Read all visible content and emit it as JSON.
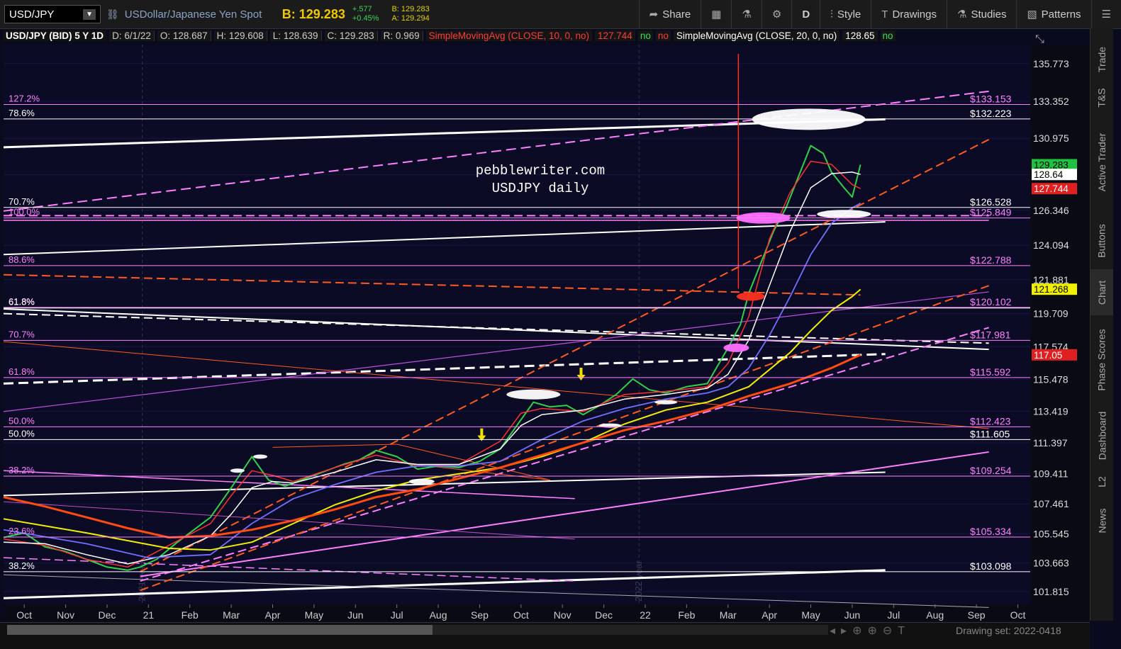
{
  "toolbar": {
    "symbol": "USD/JPY",
    "description": "USDollar/Japanese Yen Spot",
    "bid": "B: 129.283",
    "change": "+.577",
    "change_pct": "+0.45%",
    "bid_small": "B: 129.283",
    "ask_small": "A: 129.294",
    "share": "Share",
    "period": "D",
    "style": "Style",
    "drawings": "Drawings",
    "studies": "Studies",
    "patterns": "Patterns"
  },
  "infobar": {
    "symbol": "USD/JPY (BID) 5 Y 1D",
    "date": "D: 6/1/22",
    "open": "O: 128.687",
    "high": "H: 129.608",
    "low": "L: 128.639",
    "close": "C: 129.283",
    "range": "R: 0.969",
    "sma10": "SimpleMovingAvg (CLOSE, 10, 0, no)",
    "sma10_val": "127.744",
    "no1": "no",
    "no2": "no",
    "sma20": "SimpleMovingAvg (CLOSE, 20, 0, no)",
    "sma20_val": "128.65",
    "no3": "no"
  },
  "side_tabs": [
    "Trade",
    "T&S",
    "Active Trader",
    "Buttons",
    "Chart",
    "Phase Scores",
    "Dashboard",
    "L2",
    "News"
  ],
  "bottom": {
    "drawing_set": "Drawing set: 2022-0418"
  },
  "colors": {
    "background": "#0a0a1e",
    "price": "#2fd14a",
    "sma10": "#ff3030",
    "sma20": "#ffffff",
    "sma50": "#7070ff",
    "sma100": "#f0f000",
    "sma200": "#ff4a10",
    "fib": "#ff80ff"
  },
  "chart_data": {
    "type": "line",
    "title": "pebblewriter.com",
    "subtitle": "USDJPY daily",
    "ylim": [
      101.0,
      137.0
    ],
    "y_ticks": [
      135.773,
      133.352,
      130.975,
      128.64,
      126.346,
      124.094,
      121.881,
      119.709,
      117.574,
      115.478,
      113.419,
      111.397,
      109.411,
      107.461,
      105.545,
      103.663,
      101.815
    ],
    "x_months": [
      {
        "label": "Oct",
        "t": 0.5
      },
      {
        "label": "Nov",
        "t": 1.5
      },
      {
        "label": "Dec",
        "t": 2.5
      },
      {
        "label": "21",
        "t": 3.5
      },
      {
        "label": "Feb",
        "t": 4.5
      },
      {
        "label": "Mar",
        "t": 5.5
      },
      {
        "label": "Apr",
        "t": 6.5
      },
      {
        "label": "May",
        "t": 7.5
      },
      {
        "label": "Jun",
        "t": 8.5
      },
      {
        "label": "Jul",
        "t": 9.5
      },
      {
        "label": "Aug",
        "t": 10.5
      },
      {
        "label": "Sep",
        "t": 11.5
      },
      {
        "label": "Oct",
        "t": 12.5
      },
      {
        "label": "Nov",
        "t": 13.5
      },
      {
        "label": "Dec",
        "t": 14.5
      },
      {
        "label": "22",
        "t": 15.5
      },
      {
        "label": "Feb",
        "t": 16.5
      },
      {
        "label": "Mar",
        "t": 17.5
      },
      {
        "label": "Apr",
        "t": 18.5
      },
      {
        "label": "May",
        "t": 19.5
      },
      {
        "label": "Jun",
        "t": 20.5
      },
      {
        "label": "Jul",
        "t": 21.5
      },
      {
        "label": "Aug",
        "t": 22.5
      },
      {
        "label": "Sep",
        "t": 23.5
      },
      {
        "label": "Oct",
        "t": 24.5
      }
    ],
    "year_markers": [
      {
        "label": "2021 year",
        "t": 3.35
      },
      {
        "label": "2022 year",
        "t": 15.35
      }
    ],
    "series": [
      {
        "name": "USD/JPY",
        "role": "price",
        "t": [
          0.0,
          0.5,
          1.0,
          1.5,
          2.0,
          2.5,
          3.0,
          3.3,
          3.7,
          4.2,
          4.6,
          5.0,
          5.5,
          6.0,
          6.4,
          6.8,
          7.2,
          7.7,
          8.2,
          8.6,
          9.0,
          9.5,
          10.0,
          10.5,
          11.0,
          11.5,
          12.0,
          12.4,
          12.8,
          13.2,
          13.6,
          14.0,
          14.4,
          14.8,
          15.2,
          15.6,
          16.0,
          16.5,
          17.0,
          17.5,
          17.8,
          18.0,
          18.3,
          18.6,
          18.9,
          19.2,
          19.5,
          19.8,
          20.0,
          20.3,
          20.5,
          20.7
        ],
        "values": [
          105.3,
          105.6,
          104.7,
          104.4,
          103.9,
          103.4,
          103.2,
          103.4,
          103.9,
          105.0,
          105.8,
          106.6,
          108.5,
          110.5,
          109.0,
          108.6,
          109.0,
          109.5,
          110.0,
          110.3,
          110.9,
          110.5,
          109.7,
          109.9,
          109.8,
          110.2,
          111.0,
          112.5,
          114.0,
          113.7,
          113.8,
          113.2,
          113.8,
          114.5,
          115.5,
          114.8,
          114.6,
          115.0,
          115.2,
          117.5,
          119.0,
          121.0,
          123.0,
          125.0,
          126.5,
          128.5,
          130.5,
          130.0,
          128.8,
          127.8,
          127.2,
          129.28
        ]
      },
      {
        "name": "SMA 10",
        "role": "sma10",
        "t": [
          0.0,
          1.0,
          2.0,
          3.0,
          4.0,
          5.0,
          5.5,
          6.0,
          6.5,
          7.0,
          8.0,
          9.0,
          10.0,
          11.0,
          12.0,
          12.5,
          13.0,
          14.0,
          15.0,
          16.0,
          17.0,
          17.5,
          18.0,
          18.5,
          19.0,
          19.5,
          20.0,
          20.5,
          20.7
        ],
        "values": [
          105.2,
          104.8,
          103.9,
          103.4,
          104.8,
          106.2,
          108.0,
          109.6,
          109.3,
          108.9,
          109.8,
          110.6,
          109.9,
          110.0,
          111.5,
          113.3,
          113.6,
          113.4,
          114.5,
          114.7,
          115.0,
          116.5,
          119.5,
          124.5,
          127.5,
          129.5,
          129.3,
          128.0,
          127.74
        ]
      },
      {
        "name": "SMA 20",
        "role": "sma20",
        "t": [
          0.0,
          1.0,
          2.0,
          3.0,
          4.0,
          5.0,
          5.5,
          6.0,
          6.5,
          7.0,
          8.0,
          9.0,
          10.0,
          11.0,
          12.0,
          12.5,
          13.0,
          14.0,
          15.0,
          16.0,
          17.0,
          17.5,
          18.0,
          18.5,
          19.0,
          19.5,
          20.0,
          20.5,
          20.7
        ],
        "values": [
          105.0,
          104.9,
          104.2,
          103.6,
          104.2,
          105.4,
          106.8,
          108.5,
          108.9,
          108.8,
          109.5,
          110.3,
          110.0,
          110.0,
          111.0,
          112.5,
          113.2,
          113.5,
          114.2,
          114.5,
          114.9,
          115.8,
          118.0,
          121.5,
          125.0,
          127.8,
          128.7,
          128.8,
          128.65
        ]
      },
      {
        "name": "SMA 50",
        "role": "sma50",
        "t": [
          0.0,
          2.0,
          3.5,
          5.0,
          6.0,
          7.0,
          8.0,
          9.0,
          10.0,
          11.0,
          12.0,
          13.0,
          14.0,
          15.0,
          16.0,
          17.0,
          17.5,
          18.0,
          18.5,
          19.0,
          19.5,
          20.0,
          20.5,
          20.7
        ],
        "values": [
          105.8,
          104.9,
          104.0,
          104.2,
          106.2,
          107.8,
          108.7,
          109.5,
          109.9,
          109.9,
          110.2,
          111.6,
          112.8,
          113.6,
          114.2,
          114.6,
          115.0,
          116.2,
          118.3,
          120.8,
          123.5,
          125.5,
          126.5,
          126.8
        ]
      },
      {
        "name": "SMA 100",
        "role": "sma100",
        "t": [
          0.0,
          2.0,
          4.0,
          5.0,
          6.0,
          7.0,
          8.0,
          9.0,
          10.0,
          11.0,
          12.0,
          13.0,
          14.0,
          15.0,
          16.0,
          17.0,
          18.0,
          19.0,
          19.5,
          20.0,
          20.5,
          20.7
        ],
        "values": [
          106.5,
          105.6,
          104.6,
          104.5,
          105.0,
          106.2,
          107.4,
          108.3,
          109.0,
          109.4,
          109.8,
          110.5,
          111.4,
          112.6,
          113.5,
          114.0,
          115.0,
          117.2,
          118.6,
          119.9,
          120.8,
          121.26
        ]
      },
      {
        "name": "SMA 200",
        "role": "sma200",
        "t": [
          0.0,
          1.0,
          2.0,
          3.0,
          4.0,
          5.0,
          6.0,
          7.0,
          8.0,
          9.0,
          10.0,
          11.0,
          12.0,
          13.0,
          14.0,
          15.0,
          16.0,
          17.0,
          18.0,
          19.0,
          20.0,
          20.7
        ],
        "values": [
          107.9,
          107.3,
          106.6,
          105.9,
          105.3,
          105.4,
          105.8,
          106.4,
          107.1,
          107.9,
          108.4,
          109.1,
          109.8,
          110.6,
          111.4,
          112.2,
          112.8,
          113.5,
          114.4,
          115.2,
          116.2,
          117.05
        ]
      }
    ],
    "right_labels": [
      {
        "text": "$133.153",
        "y": 133.15,
        "color": "#ff80ff"
      },
      {
        "text": "$132.223",
        "y": 132.22,
        "color": "#ffffff"
      },
      {
        "text": "$126.528",
        "y": 126.53,
        "color": "#ffffff"
      },
      {
        "text": "$125.849",
        "y": 125.85,
        "color": "#ff80ff"
      },
      {
        "text": "$122.788",
        "y": 122.79,
        "color": "#ff80ff"
      },
      {
        "text": "$120.102",
        "y": 120.1,
        "color": "#ff80ff"
      },
      {
        "text": "$117.981",
        "y": 117.98,
        "color": "#ff80ff"
      },
      {
        "text": "$115.592",
        "y": 115.59,
        "color": "#ff80ff"
      },
      {
        "text": "$112.423",
        "y": 112.42,
        "color": "#ff80ff"
      },
      {
        "text": "$111.605",
        "y": 111.6,
        "color": "#ffffff"
      },
      {
        "text": "$109.254",
        "y": 109.25,
        "color": "#ff80ff"
      },
      {
        "text": "$105.334",
        "y": 105.33,
        "color": "#ff80ff"
      },
      {
        "text": "$103.098",
        "y": 103.1,
        "color": "#ffffff"
      }
    ],
    "fib_levels": [
      {
        "text": "127.2%",
        "y": 133.15,
        "color": "#ff80ff"
      },
      {
        "text": "78.6%",
        "y": 132.22,
        "color": "#ffffff"
      },
      {
        "text": "70.7%",
        "y": 126.53,
        "color": "#ffffff"
      },
      {
        "text": "100.0%",
        "y": 125.85,
        "color": "#ff80ff"
      },
      {
        "text": "88.6%",
        "y": 122.79,
        "color": "#ff80ff"
      },
      {
        "text": "61.8%",
        "y": 120.1,
        "color": "#ff80ff"
      },
      {
        "text": "61.8%",
        "y": 120.06,
        "color": "#ffffff"
      },
      {
        "text": "70.7%",
        "y": 117.98,
        "color": "#ff80ff"
      },
      {
        "text": "61.8%",
        "y": 115.59,
        "color": "#ff80ff"
      },
      {
        "text": "50.0%",
        "y": 112.42,
        "color": "#ff80ff"
      },
      {
        "text": "50.0%",
        "y": 111.6,
        "color": "#ffffff"
      },
      {
        "text": "38.2%",
        "y": 109.25,
        "color": "#ff80ff"
      },
      {
        "text": "23.6%",
        "y": 105.33,
        "color": "#ff80ff"
      },
      {
        "text": "38.2%",
        "y": 103.1,
        "color": "#ffffff"
      }
    ],
    "price_badges": [
      {
        "text": "129.283",
        "y": 129.28,
        "bg": "#20c040",
        "fg": "#000000"
      },
      {
        "text": "128.64",
        "y": 128.65,
        "bg": "#ffffff",
        "fg": "#000000"
      },
      {
        "text": "127.744",
        "y": 127.74,
        "bg": "#e02020",
        "fg": "#ffffff"
      },
      {
        "text": "121.268",
        "y": 121.27,
        "bg": "#f0f000",
        "fg": "#000000"
      },
      {
        "text": "117.05",
        "y": 117.05,
        "bg": "#e02020",
        "fg": "#ffffff"
      }
    ],
    "trendlines": [
      {
        "t1": 0.0,
        "y1": 130.4,
        "t2": 21.3,
        "y2": 132.2,
        "color": "#ffffff",
        "w": 3,
        "dash": ""
      },
      {
        "t1": 0.0,
        "y1": 123.5,
        "t2": 21.3,
        "y2": 125.6,
        "color": "#ffffff",
        "w": 2,
        "dash": ""
      },
      {
        "t1": 0.0,
        "y1": 115.2,
        "t2": 21.3,
        "y2": 117.1,
        "color": "#ffffff",
        "w": 3,
        "dash": "14,7"
      },
      {
        "t1": 0.0,
        "y1": 108.0,
        "t2": 21.3,
        "y2": 109.5,
        "color": "#ffffff",
        "w": 2,
        "dash": ""
      },
      {
        "t1": 0.0,
        "y1": 101.4,
        "t2": 21.3,
        "y2": 103.2,
        "color": "#ffffff",
        "w": 3,
        "dash": ""
      },
      {
        "t1": 0.0,
        "y1": 120.0,
        "t2": 23.8,
        "y2": 117.4,
        "color": "#ffffff",
        "w": 2,
        "dash": ""
      },
      {
        "t1": 0.0,
        "y1": 119.7,
        "t2": 23.8,
        "y2": 117.8,
        "color": "#ffffff",
        "w": 2,
        "dash": "12,6"
      },
      {
        "t1": 0.0,
        "y1": 102.9,
        "t2": 23.8,
        "y2": 100.8,
        "color": "#aaaaaa",
        "w": 1,
        "dash": ""
      },
      {
        "t1": 0.0,
        "y1": 126.0,
        "t2": 23.8,
        "y2": 126.0,
        "color": "#ff80ff",
        "w": 2,
        "dash": "12,6"
      },
      {
        "t1": 0.0,
        "y1": 125.7,
        "t2": 23.8,
        "y2": 125.7,
        "color": "#ff80ff",
        "w": 1.5,
        "dash": ""
      },
      {
        "t1": 0.0,
        "y1": 126.3,
        "t2": 23.8,
        "y2": 134.0,
        "color": "#ff80ff",
        "w": 2,
        "dash": "14,7"
      },
      {
        "t1": 0.0,
        "y1": 113.4,
        "t2": 23.8,
        "y2": 121.1,
        "color": "#c050e0",
        "w": 1.2,
        "dash": ""
      },
      {
        "t1": 3.3,
        "y1": 102.8,
        "t2": 23.8,
        "y2": 110.8,
        "color": "#ff80ff",
        "w": 2,
        "dash": ""
      },
      {
        "t1": 3.3,
        "y1": 102.5,
        "t2": 23.8,
        "y2": 118.8,
        "color": "#ff80ff",
        "w": 2,
        "dash": "12,6"
      },
      {
        "t1": 0.0,
        "y1": 122.2,
        "t2": 20.7,
        "y2": 120.9,
        "color": "#ff5a20",
        "w": 2,
        "dash": "12,6"
      },
      {
        "t1": 3.3,
        "y1": 103.1,
        "t2": 23.8,
        "y2": 130.9,
        "color": "#ff5a20",
        "w": 2,
        "dash": "12,6"
      },
      {
        "t1": 3.3,
        "y1": 101.9,
        "t2": 23.8,
        "y2": 121.5,
        "color": "#ff5a20",
        "w": 2,
        "dash": "12,6"
      },
      {
        "t1": 0.0,
        "y1": 109.6,
        "t2": 13.8,
        "y2": 107.8,
        "color": "#ff80ff",
        "w": 1.5,
        "dash": ""
      },
      {
        "t1": 0.0,
        "y1": 107.6,
        "t2": 13.8,
        "y2": 105.2,
        "color": "#c050c0",
        "w": 1,
        "dash": ""
      },
      {
        "t1": 0.0,
        "y1": 104.0,
        "t2": 13.8,
        "y2": 102.5,
        "color": "#ff80ff",
        "w": 1.5,
        "dash": "12,6"
      },
      {
        "t1": 0.0,
        "y1": 117.9,
        "t2": 23.8,
        "y2": 112.3,
        "color": "#ff5a20",
        "w": 1,
        "dash": ""
      },
      {
        "t1": 6.5,
        "y1": 111.1,
        "t2": 9.5,
        "y2": 111.3,
        "color": "#ff5a20",
        "w": 1,
        "dash": ""
      },
      {
        "t1": 9.5,
        "y1": 111.3,
        "t2": 13.2,
        "y2": 109.0,
        "color": "#ff5a20",
        "w": 1,
        "dash": ""
      },
      {
        "t1": 9.3,
        "y1": 110.2,
        "t2": 13.2,
        "y2": 109.0,
        "color": "#ff5a20",
        "w": 1,
        "dash": ""
      }
    ],
    "vline": {
      "t": 17.75,
      "y1": 136.4,
      "y2": 121.3,
      "color": "#ff3020"
    },
    "ellipses": [
      {
        "t": 19.45,
        "y": 132.2,
        "rx": 80,
        "ry": 15,
        "color": "#ffffff"
      },
      {
        "t": 18.35,
        "y": 125.85,
        "rx": 38,
        "ry": 8,
        "color": "#ff70ff"
      },
      {
        "t": 20.3,
        "y": 126.1,
        "rx": 38,
        "ry": 6,
        "color": "#ffffff"
      },
      {
        "t": 18.05,
        "y": 120.8,
        "rx": 20,
        "ry": 6,
        "color": "#ff3020"
      },
      {
        "t": 17.7,
        "y": 117.5,
        "rx": 18,
        "ry": 6,
        "color": "#ff70ff"
      },
      {
        "t": 12.8,
        "y": 114.5,
        "rx": 38,
        "ry": 7,
        "color": "#ffffff"
      },
      {
        "t": 16.0,
        "y": 114.0,
        "rx": 16,
        "ry": 3,
        "color": "#ffffff"
      },
      {
        "t": 14.65,
        "y": 112.5,
        "rx": 16,
        "ry": 3,
        "color": "#ffffff"
      },
      {
        "t": 10.1,
        "y": 108.9,
        "rx": 18,
        "ry": 4,
        "color": "#ffffff"
      },
      {
        "t": 6.2,
        "y": 110.5,
        "rx": 10,
        "ry": 3,
        "color": "#ffffff"
      },
      {
        "t": 5.65,
        "y": 109.6,
        "rx": 10,
        "ry": 3,
        "color": "#ffffff"
      }
    ],
    "arrows": [
      {
        "t": 13.95,
        "y": 115.4
      },
      {
        "t": 11.55,
        "y": 111.5
      }
    ]
  }
}
